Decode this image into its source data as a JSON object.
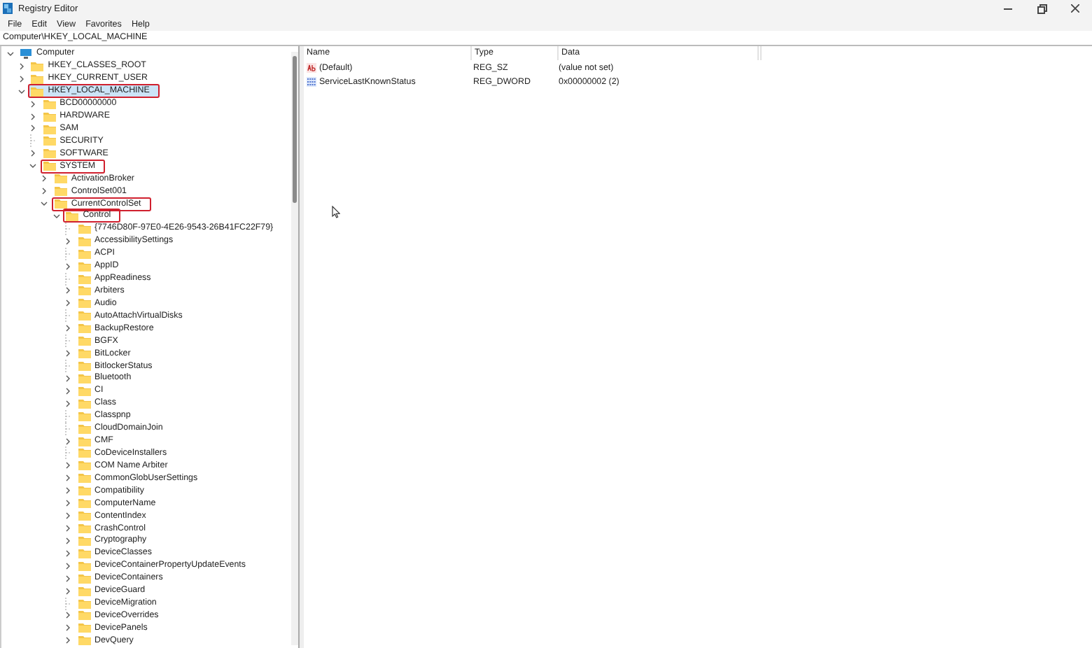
{
  "window": {
    "title": "Registry Editor"
  },
  "menu": [
    "File",
    "Edit",
    "View",
    "Favorites",
    "Help"
  ],
  "address": "Computer\\HKEY_LOCAL_MACHINE",
  "tree": [
    {
      "label": "Computer",
      "kind": "computer",
      "expanded": true,
      "selected": false,
      "highlighted": false,
      "children": [
        {
          "label": "HKEY_CLASSES_ROOT",
          "expanded": false,
          "selected": false,
          "highlighted": false
        },
        {
          "label": "HKEY_CURRENT_USER",
          "expanded": false,
          "selected": false,
          "highlighted": false
        },
        {
          "label": "HKEY_LOCAL_MACHINE",
          "expanded": true,
          "selected": true,
          "highlighted": true,
          "children": [
            {
              "label": "BCD00000000",
              "expanded": false,
              "selected": false,
              "highlighted": false
            },
            {
              "label": "HARDWARE",
              "expanded": false,
              "selected": false,
              "highlighted": false
            },
            {
              "label": "SAM",
              "expanded": false,
              "selected": false,
              "highlighted": false
            },
            {
              "label": "SECURITY",
              "leaf": true,
              "selected": false,
              "highlighted": false
            },
            {
              "label": "SOFTWARE",
              "expanded": false,
              "selected": false,
              "highlighted": false
            },
            {
              "label": "SYSTEM",
              "expanded": true,
              "selected": false,
              "highlighted": true,
              "children": [
                {
                  "label": "ActivationBroker",
                  "expanded": false,
                  "selected": false,
                  "highlighted": false
                },
                {
                  "label": "ControlSet001",
                  "expanded": false,
                  "selected": false,
                  "highlighted": false
                },
                {
                  "label": "CurrentControlSet",
                  "expanded": true,
                  "selected": false,
                  "highlighted": true,
                  "children": [
                    {
                      "label": "Control",
                      "expanded": true,
                      "selected": false,
                      "highlighted": true,
                      "children": [
                        {
                          "label": "{7746D80F-97E0-4E26-9543-26B41FC22F79}",
                          "leaf": true,
                          "selected": false,
                          "highlighted": false
                        },
                        {
                          "label": "AccessibilitySettings",
                          "expanded": false,
                          "selected": false,
                          "highlighted": false
                        },
                        {
                          "label": "ACPI",
                          "leaf": true,
                          "selected": false,
                          "highlighted": false
                        },
                        {
                          "label": "AppID",
                          "expanded": false,
                          "selected": false,
                          "highlighted": false
                        },
                        {
                          "label": "AppReadiness",
                          "leaf": true,
                          "selected": false,
                          "highlighted": false
                        },
                        {
                          "label": "Arbiters",
                          "expanded": false,
                          "selected": false,
                          "highlighted": false
                        },
                        {
                          "label": "Audio",
                          "expanded": false,
                          "selected": false,
                          "highlighted": false
                        },
                        {
                          "label": "AutoAttachVirtualDisks",
                          "leaf": true,
                          "selected": false,
                          "highlighted": false
                        },
                        {
                          "label": "BackupRestore",
                          "expanded": false,
                          "selected": false,
                          "highlighted": false
                        },
                        {
                          "label": "BGFX",
                          "leaf": true,
                          "selected": false,
                          "highlighted": false
                        },
                        {
                          "label": "BitLocker",
                          "expanded": false,
                          "selected": false,
                          "highlighted": false
                        },
                        {
                          "label": "BitlockerStatus",
                          "leaf": true,
                          "selected": false,
                          "highlighted": false
                        },
                        {
                          "label": "Bluetooth",
                          "expanded": false,
                          "selected": false,
                          "highlighted": false
                        },
                        {
                          "label": "CI",
                          "expanded": false,
                          "selected": false,
                          "highlighted": false
                        },
                        {
                          "label": "Class",
                          "expanded": false,
                          "selected": false,
                          "highlighted": false
                        },
                        {
                          "label": "Classpnp",
                          "leaf": true,
                          "selected": false,
                          "highlighted": false
                        },
                        {
                          "label": "CloudDomainJoin",
                          "leaf": true,
                          "selected": false,
                          "highlighted": false
                        },
                        {
                          "label": "CMF",
                          "expanded": false,
                          "selected": false,
                          "highlighted": false
                        },
                        {
                          "label": "CoDeviceInstallers",
                          "leaf": true,
                          "selected": false,
                          "highlighted": false
                        },
                        {
                          "label": "COM Name Arbiter",
                          "expanded": false,
                          "selected": false,
                          "highlighted": false
                        },
                        {
                          "label": "CommonGlobUserSettings",
                          "expanded": false,
                          "selected": false,
                          "highlighted": false
                        },
                        {
                          "label": "Compatibility",
                          "expanded": false,
                          "selected": false,
                          "highlighted": false
                        },
                        {
                          "label": "ComputerName",
                          "expanded": false,
                          "selected": false,
                          "highlighted": false
                        },
                        {
                          "label": "ContentIndex",
                          "expanded": false,
                          "selected": false,
                          "highlighted": false
                        },
                        {
                          "label": "CrashControl",
                          "expanded": false,
                          "selected": false,
                          "highlighted": false
                        },
                        {
                          "label": "Cryptography",
                          "expanded": false,
                          "selected": false,
                          "highlighted": false
                        },
                        {
                          "label": "DeviceClasses",
                          "expanded": false,
                          "selected": false,
                          "highlighted": false
                        },
                        {
                          "label": "DeviceContainerPropertyUpdateEvents",
                          "expanded": false,
                          "selected": false,
                          "highlighted": false
                        },
                        {
                          "label": "DeviceContainers",
                          "expanded": false,
                          "selected": false,
                          "highlighted": false
                        },
                        {
                          "label": "DeviceGuard",
                          "expanded": false,
                          "selected": false,
                          "highlighted": false
                        },
                        {
                          "label": "DeviceMigration",
                          "leaf": true,
                          "selected": false,
                          "highlighted": false
                        },
                        {
                          "label": "DeviceOverrides",
                          "expanded": false,
                          "selected": false,
                          "highlighted": false
                        },
                        {
                          "label": "DevicePanels",
                          "expanded": false,
                          "selected": false,
                          "highlighted": false
                        },
                        {
                          "label": "DevQuery",
                          "expanded": false,
                          "selected": false,
                          "highlighted": false
                        }
                      ]
                    }
                  ]
                }
              ]
            }
          ]
        }
      ]
    }
  ],
  "values": {
    "columns": [
      "Name",
      "Type",
      "Data"
    ],
    "rows": [
      {
        "kind": "string",
        "name": "(Default)",
        "type": "REG_SZ",
        "data": "(value not set)"
      },
      {
        "kind": "binary",
        "name": "ServiceLastKnownStatus",
        "type": "REG_DWORD",
        "data": "0x00000002 (2)"
      }
    ]
  }
}
